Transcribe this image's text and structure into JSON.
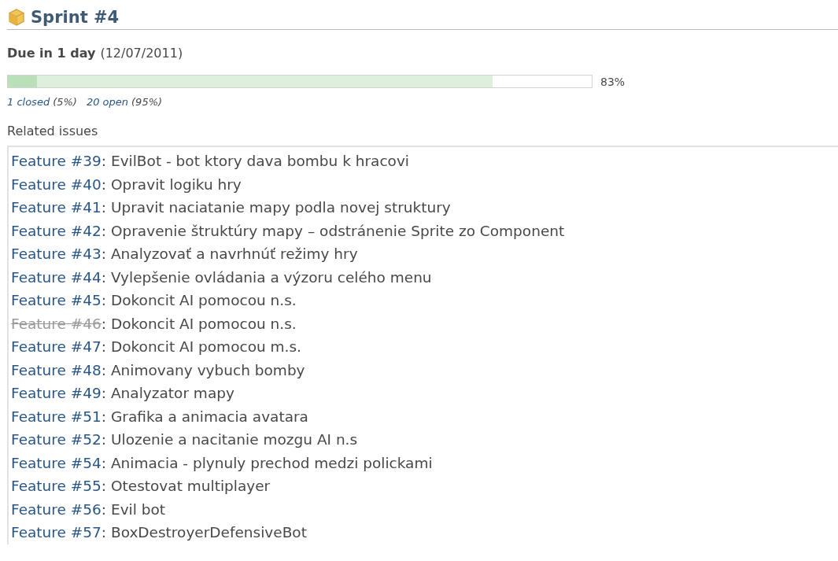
{
  "title": "Sprint #4",
  "due": {
    "label": "Due in 1 day",
    "date": "(12/07/2011)"
  },
  "progress": {
    "closed": {
      "level": 0.05
    },
    "done": {
      "level": 0.83
    },
    "reading": "83%"
  },
  "counts": [
    {
      "link": "1 closed",
      "percent": "(5%)"
    },
    {
      "link": "20 open",
      "percent": "(95%)"
    }
  ],
  "related_heading": "Related issues",
  "issues": [
    {
      "link": "Feature #39",
      "subject": ": EvilBot - bot ktory dava bombu k hracovi",
      "closed": false
    },
    {
      "link": "Feature #40",
      "subject": ": Opravit logiku hry",
      "closed": false
    },
    {
      "link": "Feature #41",
      "subject": ": Upravit naciatanie mapy podla novej struktury",
      "closed": false
    },
    {
      "link": "Feature #42",
      "subject": ": Opravenie štruktúry mapy – odstránenie Sprite zo Component",
      "closed": false
    },
    {
      "link": "Feature #43",
      "subject": ": Analyzovať a navrhnúť režimy hry",
      "closed": false
    },
    {
      "link": "Feature #44",
      "subject": ": Vylepšenie ovládania a výzoru celého menu",
      "closed": false
    },
    {
      "link": "Feature #45",
      "subject": ": Dokoncit AI pomocou n.s.",
      "closed": false
    },
    {
      "link": "Feature #46",
      "subject": ": Dokoncit AI pomocou n.s.",
      "closed": true
    },
    {
      "link": "Feature #47",
      "subject": ": Dokoncit AI pomocou m.s.",
      "closed": false
    },
    {
      "link": "Feature #48",
      "subject": ": Animovany vybuch bomby",
      "closed": false
    },
    {
      "link": "Feature #49",
      "subject": ": Analyzator mapy",
      "closed": false
    },
    {
      "link": "Feature #51",
      "subject": ": Grafika a animacia avatara",
      "closed": false
    },
    {
      "link": "Feature #52",
      "subject": ": Ulozenie a nacitanie mozgu AI n.s",
      "closed": false
    },
    {
      "link": "Feature #54",
      "subject": ": Animacia - plynuly prechod medzi polickami",
      "closed": false
    },
    {
      "link": "Feature #55",
      "subject": ": Otestovat multiplayer",
      "closed": false
    },
    {
      "link": "Feature #56",
      "subject": ": Evil bot",
      "closed": false
    },
    {
      "link": "Feature #57",
      "subject": ": BoxDestroyerDefensiveBot",
      "closed": false
    }
  ]
}
